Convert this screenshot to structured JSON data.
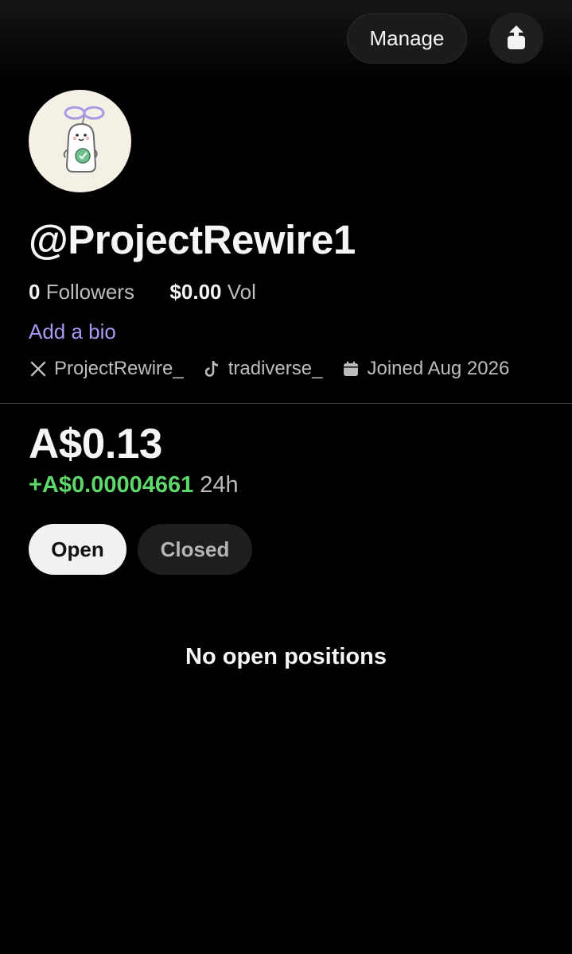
{
  "header": {
    "manage_label": "Manage",
    "share_icon": "share-icon"
  },
  "profile": {
    "avatar_icon": "mascot-avatar",
    "username": "@ProjectRewire1",
    "followers_count": "0",
    "followers_label": "Followers",
    "volume_value": "$0.00",
    "volume_label": "Vol",
    "add_bio_label": "Add a bio",
    "x_handle": "ProjectRewire_",
    "tiktok_handle": "tradiverse_",
    "joined": "Joined Aug 2026"
  },
  "portfolio": {
    "balance": "A$0.13",
    "change_value": "+A$0.00004661",
    "change_period": "24h"
  },
  "tabs": {
    "open_label": "Open",
    "closed_label": "Closed",
    "active": "Open"
  },
  "positions": {
    "empty_message": "No open positions"
  },
  "colors": {
    "background": "#000000",
    "accent_purple": "#a99af2",
    "positive_green": "#5fd86b"
  }
}
